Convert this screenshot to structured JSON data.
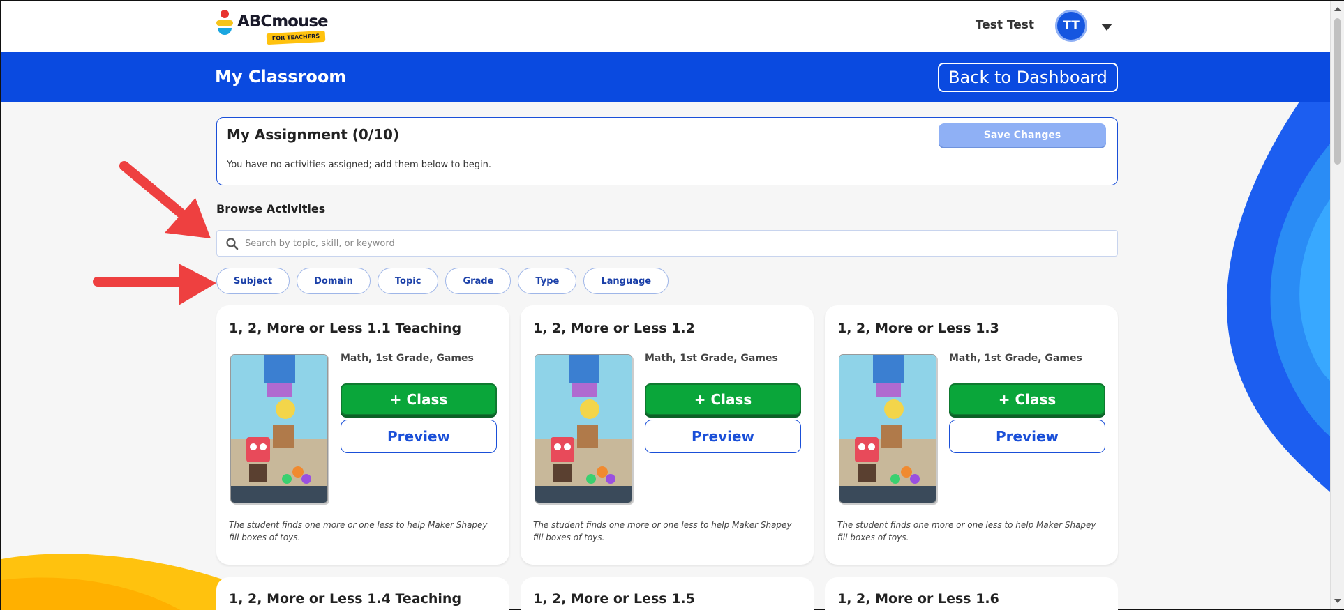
{
  "header": {
    "logo_text": "ABCmouse",
    "logo_tagline": "FOR TEACHERS",
    "user_name": "Test Test",
    "avatar_initials": "TT"
  },
  "banner": {
    "title": "My Classroom",
    "back_button": "Back to Dashboard"
  },
  "assignment": {
    "title": "My Assignment (0/10)",
    "message": "You have no activities assigned; add them below to begin.",
    "save_button": "Save Changes"
  },
  "browse": {
    "label": "Browse Activities",
    "search_placeholder": "Search by topic, skill, or keyword",
    "filters": [
      "Subject",
      "Domain",
      "Topic",
      "Grade",
      "Type",
      "Language"
    ]
  },
  "cards": [
    {
      "title": "1, 2, More or Less 1.1 Teaching",
      "meta": "Math, 1st Grade, Games",
      "class_button": "+ Class",
      "preview_button": "Preview",
      "description": "The student finds one more or one less to help Maker Shapey fill boxes of toys."
    },
    {
      "title": "1, 2, More or Less 1.2",
      "meta": "Math, 1st Grade, Games",
      "class_button": "+ Class",
      "preview_button": "Preview",
      "description": "The student finds one more or one less to help Maker Shapey fill boxes of toys."
    },
    {
      "title": "1, 2, More or Less 1.3",
      "meta": "Math, 1st Grade, Games",
      "class_button": "+ Class",
      "preview_button": "Preview",
      "description": "The student finds one more or one less to help Maker Shapey fill boxes of toys."
    }
  ],
  "next_cards": [
    {
      "title": "1, 2, More or Less 1.4 Teaching"
    },
    {
      "title": "1, 2, More or Less 1.5"
    },
    {
      "title": "1, 2, More or Less 1.6"
    }
  ],
  "colors": {
    "brand_blue": "#0a4ae0",
    "class_green": "#0aa63a",
    "annotation_arrow": "#ee4040"
  }
}
